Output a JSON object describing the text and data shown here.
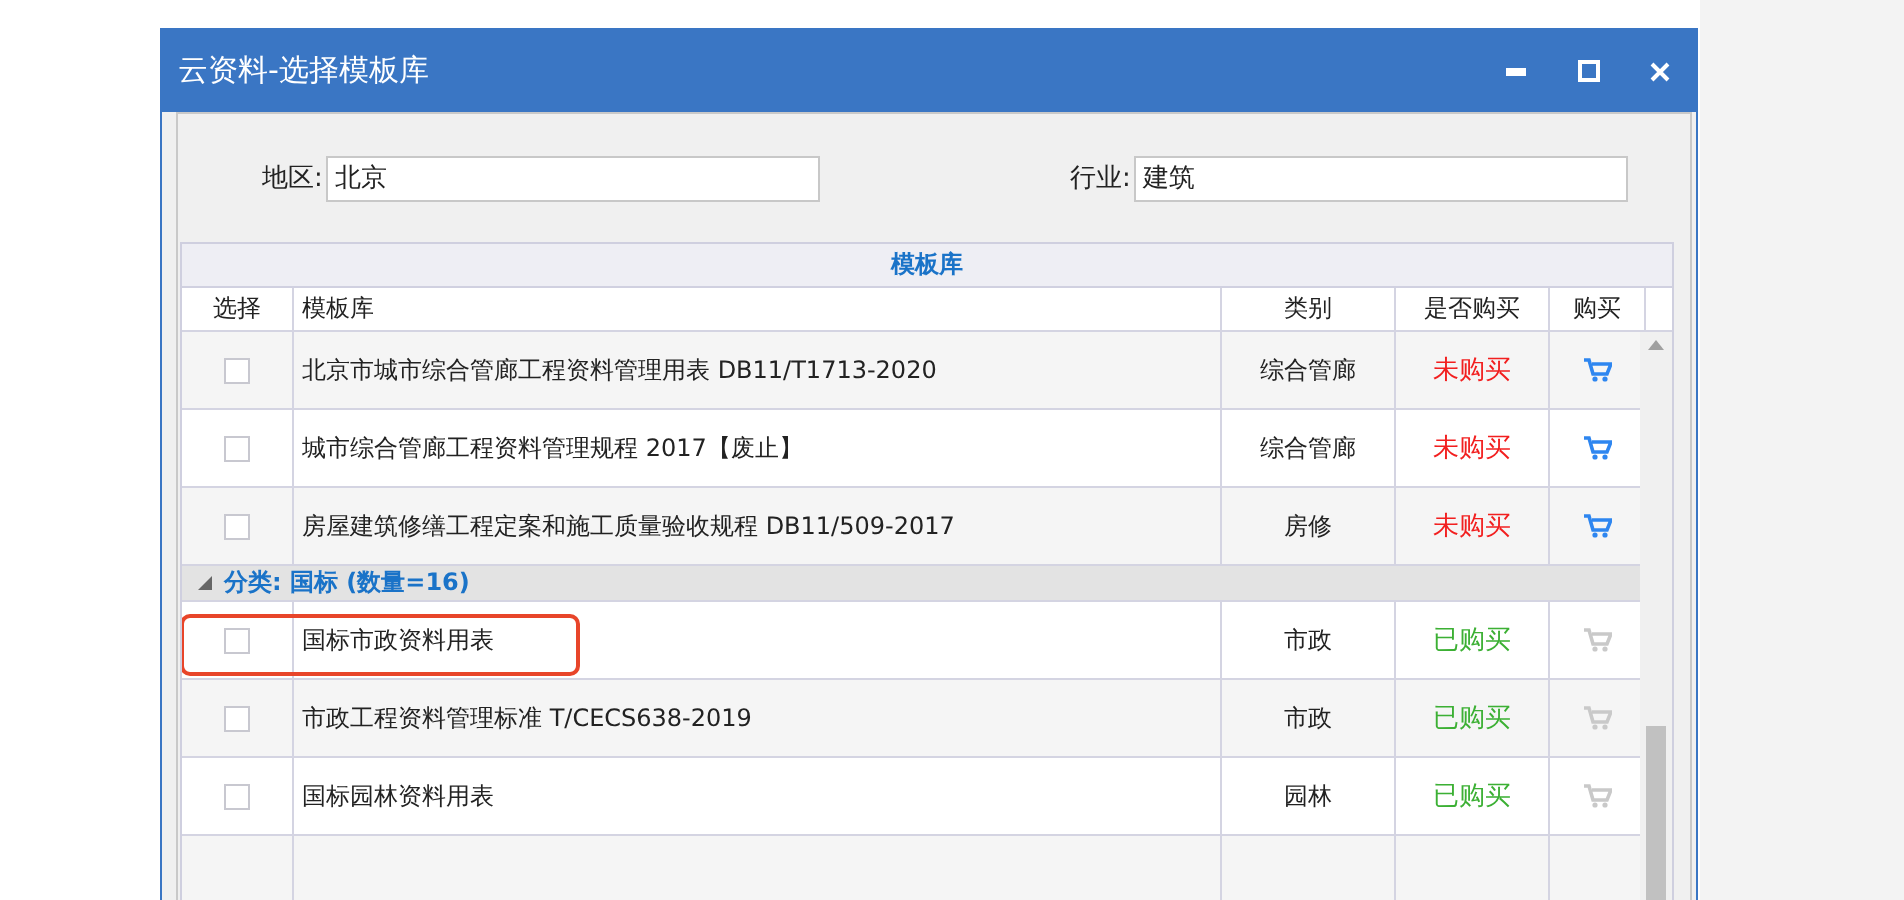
{
  "window": {
    "title": "云资料-选择模板库"
  },
  "filters": [
    {
      "label": "地区:",
      "value": "北京"
    },
    {
      "label": "行业:",
      "value": "建筑"
    }
  ],
  "table": {
    "caption": "模板库",
    "columns": [
      "选择",
      "模板库",
      "类别",
      "是否购买",
      "购买"
    ],
    "rows": [
      {
        "kind": "item",
        "checked": false,
        "name": "北京市城市综合管廊工程资料管理用表 DB11/T1713-2020",
        "category": "综合管廊",
        "purchased": false,
        "status": "未购买",
        "highlighted": false
      },
      {
        "kind": "item",
        "checked": false,
        "name": "城市综合管廊工程资料管理规程 2017【废止】",
        "category": "综合管廊",
        "purchased": false,
        "status": "未购买",
        "highlighted": false
      },
      {
        "kind": "item",
        "checked": false,
        "name": "房屋建筑修缮工程定案和施工质量验收规程 DB11/509-2017",
        "category": "房修",
        "purchased": false,
        "status": "未购买",
        "highlighted": false
      },
      {
        "kind": "group",
        "expanded": true,
        "label": "分类: 国标 (数量=16)"
      },
      {
        "kind": "item",
        "checked": false,
        "name": "国标市政资料用表",
        "category": "市政",
        "purchased": true,
        "status": "已购买",
        "highlighted": true
      },
      {
        "kind": "item",
        "checked": false,
        "name": "市政工程资料管理标准 T/CECS638-2019",
        "category": "市政",
        "purchased": true,
        "status": "已购买",
        "highlighted": false
      },
      {
        "kind": "item",
        "checked": false,
        "name": "国标园林资料用表",
        "category": "园林",
        "purchased": true,
        "status": "已购买",
        "highlighted": false
      }
    ]
  }
}
